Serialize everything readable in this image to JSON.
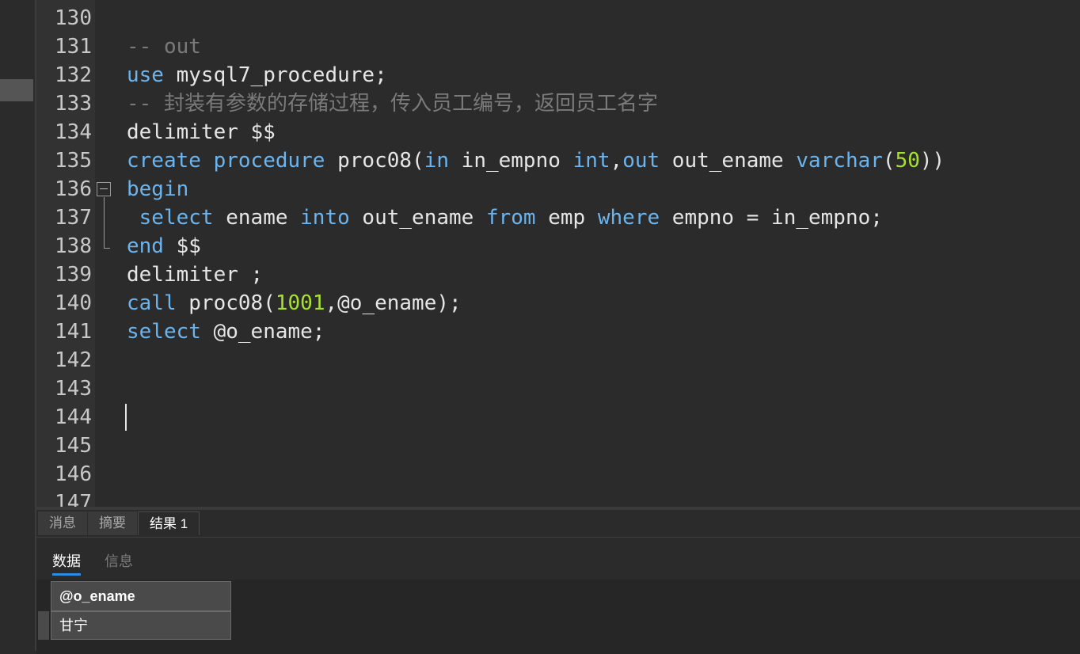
{
  "editor": {
    "lines": [
      {
        "num": "130",
        "tokens": []
      },
      {
        "num": "131",
        "tokens": [
          {
            "t": "-- out",
            "c": "cm"
          }
        ]
      },
      {
        "num": "132",
        "tokens": [
          {
            "t": "use",
            "c": "kw"
          },
          {
            "t": " mysql7_procedure;",
            "c": ""
          }
        ]
      },
      {
        "num": "133",
        "tokens": [
          {
            "t": "-- 封装有参数的存储过程，传入员工编号，返回员工名字",
            "c": "cm"
          }
        ]
      },
      {
        "num": "134",
        "tokens": [
          {
            "t": "delimiter $$",
            "c": ""
          }
        ]
      },
      {
        "num": "135",
        "tokens": [
          {
            "t": "create",
            "c": "kw"
          },
          {
            "t": " ",
            "c": ""
          },
          {
            "t": "procedure",
            "c": "kw"
          },
          {
            "t": " proc08(",
            "c": ""
          },
          {
            "t": "in",
            "c": "kw"
          },
          {
            "t": " in_empno ",
            "c": ""
          },
          {
            "t": "int",
            "c": "kw"
          },
          {
            "t": ",",
            "c": ""
          },
          {
            "t": "out",
            "c": "kw"
          },
          {
            "t": " out_ename ",
            "c": ""
          },
          {
            "t": "varchar",
            "c": "kw"
          },
          {
            "t": "(",
            "c": ""
          },
          {
            "t": "50",
            "c": "num"
          },
          {
            "t": "))",
            "c": ""
          }
        ]
      },
      {
        "num": "136",
        "tokens": [
          {
            "t": "begin",
            "c": "kw"
          }
        ]
      },
      {
        "num": "137",
        "tokens": [
          {
            "t": " select",
            "c": "kw"
          },
          {
            "t": " ename ",
            "c": ""
          },
          {
            "t": "into",
            "c": "kw"
          },
          {
            "t": " out_ename ",
            "c": ""
          },
          {
            "t": "from",
            "c": "kw"
          },
          {
            "t": " emp ",
            "c": ""
          },
          {
            "t": "where",
            "c": "kw"
          },
          {
            "t": " empno = in_empno;",
            "c": ""
          }
        ]
      },
      {
        "num": "138",
        "tokens": [
          {
            "t": "end",
            "c": "kw"
          },
          {
            "t": " $$",
            "c": ""
          }
        ]
      },
      {
        "num": "139",
        "tokens": [
          {
            "t": "delimiter ;",
            "c": ""
          }
        ]
      },
      {
        "num": "140",
        "tokens": [
          {
            "t": "call",
            "c": "kw"
          },
          {
            "t": " proc08(",
            "c": ""
          },
          {
            "t": "1001",
            "c": "num"
          },
          {
            "t": ",@o_ename);",
            "c": ""
          }
        ]
      },
      {
        "num": "141",
        "tokens": [
          {
            "t": "select",
            "c": "kw"
          },
          {
            "t": " @o_ename;",
            "c": ""
          }
        ]
      },
      {
        "num": "142",
        "tokens": []
      },
      {
        "num": "143",
        "tokens": []
      },
      {
        "num": "144",
        "tokens": []
      },
      {
        "num": "145",
        "tokens": []
      },
      {
        "num": "146",
        "tokens": []
      },
      {
        "num": "147",
        "tokens": []
      }
    ]
  },
  "result_panel": {
    "tabs": [
      "消息",
      "摘要",
      "结果 1"
    ],
    "active_tab": "结果 1",
    "subtabs": [
      "数据",
      "信息"
    ],
    "active_subtab": "数据",
    "grid": {
      "columns": [
        "@o_ename"
      ],
      "rows": [
        [
          "甘宁"
        ]
      ]
    }
  },
  "colors": {
    "keyword": "#6cb4ee",
    "comment": "#7a7a7a",
    "number": "#a6e22e",
    "text": "#e6e6e6",
    "background": "#2b2b2b",
    "accent": "#2d8ce0"
  }
}
